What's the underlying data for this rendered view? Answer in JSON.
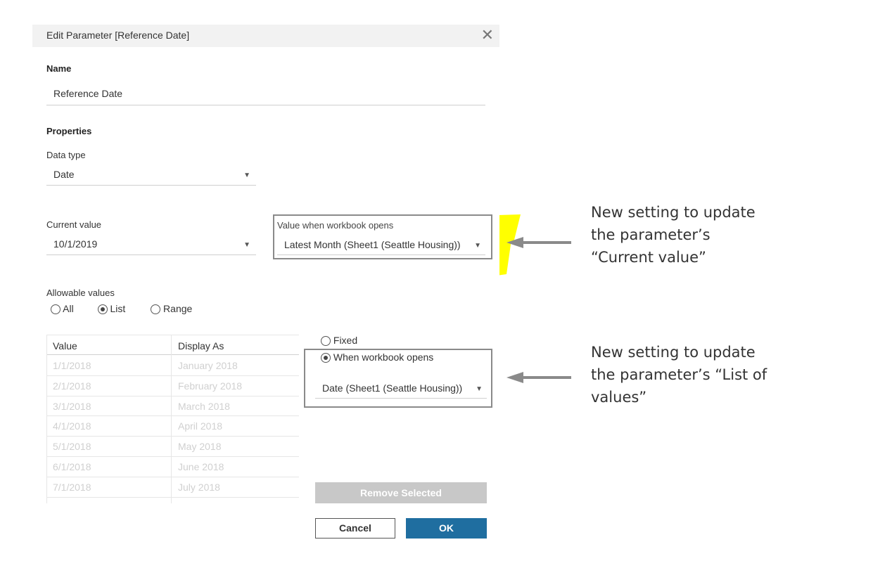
{
  "dialog": {
    "title": "Edit Parameter [Reference Date]",
    "close_glyph": "✕",
    "name_label": "Name",
    "name_value": "Reference Date",
    "properties_label": "Properties",
    "data_type_label": "Data type",
    "data_type_value": "Date",
    "current_value_label": "Current value",
    "current_value": "10/1/2019",
    "workbook_open_label": "Value when workbook opens",
    "workbook_open_value": "Latest Month (Sheet1 (Seattle Housing))",
    "allowable_label": "Allowable values",
    "allowable_options": [
      "All",
      "List",
      "Range"
    ],
    "allowable_selected": "List",
    "list_source": {
      "fixed_label": "Fixed",
      "when_opens_label": "When workbook opens",
      "selected": "When workbook opens",
      "source_value": "Date (Sheet1 (Seattle Housing))"
    },
    "table": {
      "headers": [
        "Value",
        "Display As"
      ],
      "rows": [
        [
          "1/1/2018",
          "January 2018"
        ],
        [
          "2/1/2018",
          "February 2018"
        ],
        [
          "3/1/2018",
          "March 2018"
        ],
        [
          "4/1/2018",
          "April 2018"
        ],
        [
          "5/1/2018",
          "May 2018"
        ],
        [
          "6/1/2018",
          "June 2018"
        ],
        [
          "7/1/2018",
          "July 2018"
        ]
      ]
    },
    "remove_button": "Remove Selected",
    "cancel_button": "Cancel",
    "ok_button": "OK"
  },
  "annotations": {
    "current_value_note": [
      "New setting to update",
      "the parameter’s",
      "“Current value”"
    ],
    "list_note": [
      "New setting to update",
      "the parameter’s “List of",
      "values”"
    ]
  },
  "colors": {
    "highlight": "#ffff00",
    "ok_button": "#1f6ea0",
    "remove_button": "#c8c8c8",
    "callout_box": "#8a8a8a"
  }
}
